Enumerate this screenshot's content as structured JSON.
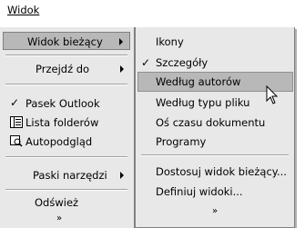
{
  "menubar": {
    "title": "Widok"
  },
  "main_menu": {
    "items": [
      {
        "label": "Widok bieżący",
        "submenu": true,
        "highlighted": true
      },
      {
        "label": "Przejdź do",
        "submenu": true
      },
      {
        "label": "Pasek Outlook",
        "checked": true
      },
      {
        "label": "Lista folderów",
        "icon": "folder-list-icon"
      },
      {
        "label": "Autopodgląd",
        "icon": "preview-icon"
      },
      {
        "label": "Paski narzędzi",
        "submenu": true
      },
      {
        "label": "Odśwież"
      }
    ],
    "expand_glyph": "»"
  },
  "sub_menu": {
    "items": [
      {
        "label": "Ikony"
      },
      {
        "label": "Szczegóły",
        "checked": true
      },
      {
        "label": "Według autorów",
        "highlighted": true
      },
      {
        "label": "Według typu pliku"
      },
      {
        "label": "Oś czasu dokumentu"
      },
      {
        "label": "Programy"
      },
      {
        "label": "Dostosuj widok bieżący..."
      },
      {
        "label": "Definiuj widoki..."
      }
    ],
    "expand_glyph": "»",
    "check_glyph": "✓"
  },
  "colors": {
    "menu_bg": "#e8e8e8",
    "highlight": "#b8b8b8",
    "border": "#808080"
  }
}
